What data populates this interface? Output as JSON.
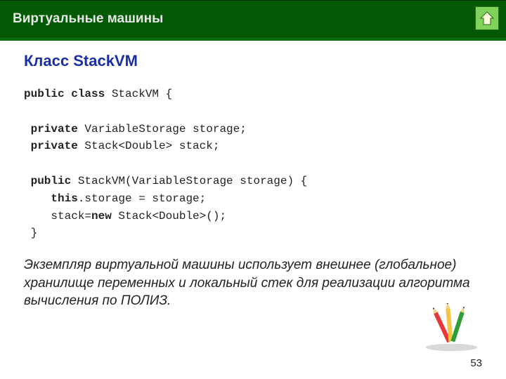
{
  "header": {
    "title": "Виртуальные машины"
  },
  "section": {
    "title": "Класс StackVM"
  },
  "code": {
    "line1a": "public class",
    "line1b": " StackVM {",
    "line2a": " private",
    "line2b": " VariableStorage storage;",
    "line3a": " private",
    "line3b": " Stack<Double> stack;",
    "line4a": " public",
    "line4b": " StackVM(VariableStorage storage) {",
    "line5a": "    this",
    "line5b": ".storage = storage;",
    "line6a": "    stack=",
    "line6b": "new",
    "line6c": " Stack<Double>();",
    "line7": " }"
  },
  "summary": "Экземпляр виртуальной машины использует внешнее (глобальное) хранилище переменных и локальный стек для реализации алгоритма вычисления по ПОЛИЗ.",
  "page": "53"
}
